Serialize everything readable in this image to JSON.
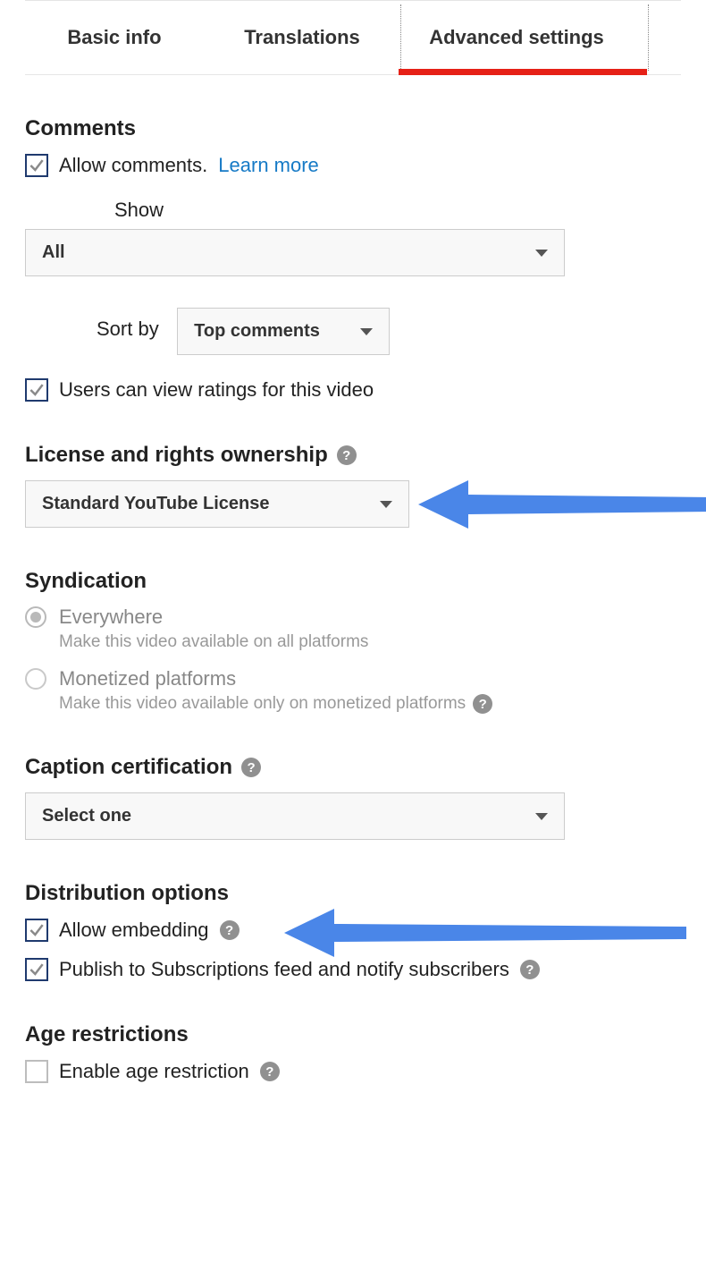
{
  "tabs": {
    "basic": "Basic info",
    "translations": "Translations",
    "advanced": "Advanced settings"
  },
  "comments": {
    "heading": "Comments",
    "allow_label": "Allow comments.",
    "learn_more": "Learn more",
    "show_label": "Show",
    "show_value": "All",
    "sort_label": "Sort by",
    "sort_value": "Top comments",
    "ratings_label": "Users can view ratings for this video"
  },
  "license": {
    "heading": "License and rights ownership",
    "value": "Standard YouTube License"
  },
  "syndication": {
    "heading": "Syndication",
    "everywhere_label": "Everywhere",
    "everywhere_sub": "Make this video available on all platforms",
    "monetized_label": "Monetized platforms",
    "monetized_sub": "Make this video available only on monetized platforms"
  },
  "caption": {
    "heading": "Caption certification",
    "value": "Select one"
  },
  "distribution": {
    "heading": "Distribution options",
    "embed_label": "Allow embedding",
    "publish_label": "Publish to Subscriptions feed and notify subscribers"
  },
  "age": {
    "heading": "Age restrictions",
    "enable_label": "Enable age restriction"
  }
}
